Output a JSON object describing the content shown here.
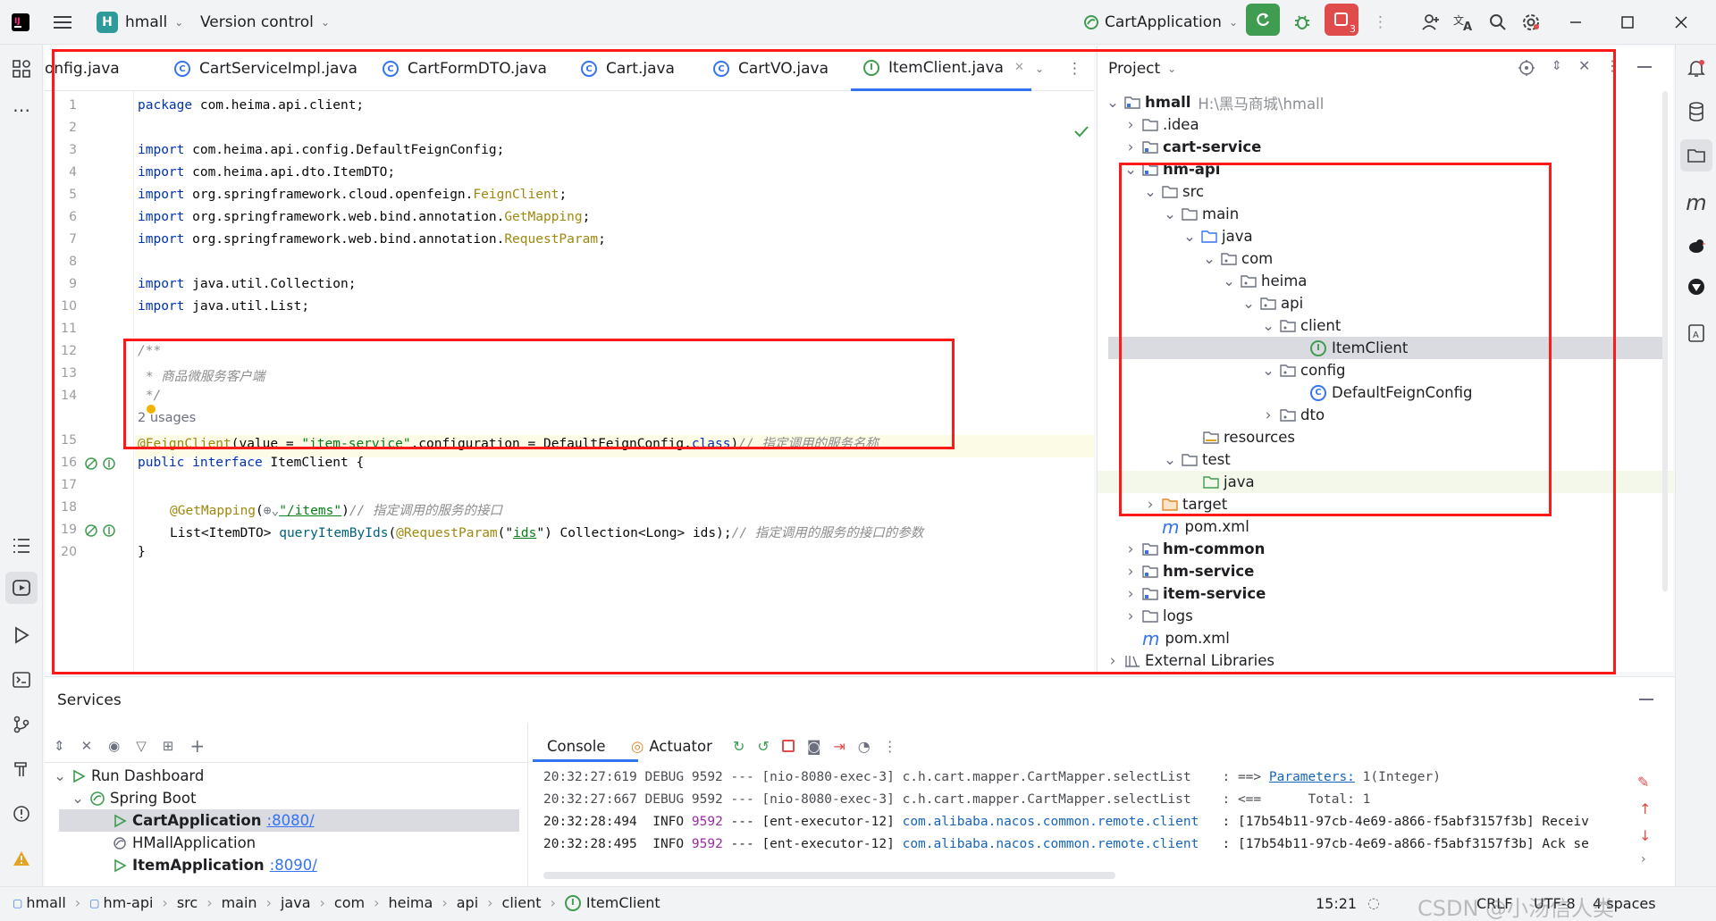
{
  "titlebar": {
    "project_badge": "H",
    "project_name": "hmall",
    "vcs": "Version control",
    "run_config": "CartApplication",
    "badge_count": "3"
  },
  "tabs": [
    {
      "label": "onfig.java",
      "icon": "class-icon"
    },
    {
      "label": "CartServiceImpl.java",
      "icon": "class-icon"
    },
    {
      "label": "CartFormDTO.java",
      "icon": "class-icon"
    },
    {
      "label": "Cart.java",
      "icon": "class-icon"
    },
    {
      "label": "CartVO.java",
      "icon": "class-icon"
    },
    {
      "label": "ItemClient.java",
      "icon": "interface-icon",
      "active": true
    }
  ],
  "code": {
    "line_numbers": [
      "1",
      "2",
      "3",
      "4",
      "5",
      "6",
      "7",
      "8",
      "9",
      "10",
      "11",
      "12",
      "13",
      "14",
      "15",
      "16",
      "17",
      "18",
      "19",
      "20"
    ],
    "l1_kw": "package",
    "l1": " com.heima.api.client;",
    "import": "import",
    "l3": " com.heima.api.config.DefaultFeignConfig;",
    "l4": " com.heima.api.dto.ItemDTO;",
    "l5a": " org.springframework.cloud.openfeign.",
    "l5b": "FeignClient",
    "l5c": ";",
    "l6a": " org.springframework.web.bind.annotation.",
    "l6b": "GetMapping",
    "l6c": ";",
    "l7a": " org.springframework.web.bind.annotation.",
    "l7b": "RequestParam",
    "l7c": ";",
    "l9": " java.util.Collection;",
    "l10": " java.util.List;",
    "l12": "/**",
    "l13": " * 商品微服务客户端",
    "l14": " */",
    "usages": "2 usages",
    "l15a": "@FeignClient",
    "l15b": "(value = ",
    "l15c": "\"item-service\"",
    "l15d": ",configuration = DefaultFeignConfig.",
    "l15e": "class",
    "l15f": ")",
    "l15g": "// 指定调用的服务名称",
    "l16a": "public interface",
    "l16b": " ItemClient {",
    "l18a": "@GetMapping",
    "l18b": "(",
    "l18c": "\"/items\"",
    "l18d": ")",
    "l18e": "// 指定调用的服务的接口",
    "l19a": "List<ItemDTO> ",
    "l19b": "queryItemByIds",
    "l19c": "(",
    "l19d": "@RequestParam",
    "l19e": "(\"",
    "l19f": "ids",
    "l19g": "\") Collection<Long> ids);",
    "l19h": "// 指定调用的服务的接口的参数",
    "l20": "}"
  },
  "project": {
    "title": "Project",
    "root": "hmall",
    "root_path": "H:\\黑马商城\\hmall",
    "nodes": {
      "idea": ".idea",
      "cart_service": "cart-service",
      "hm_api": "hm-api",
      "src": "src",
      "main": "main",
      "java": "java",
      "com": "com",
      "heima": "heima",
      "api": "api",
      "client": "client",
      "item_client": "ItemClient",
      "config": "config",
      "default_feign_config": "DefaultFeignConfig",
      "dto": "dto",
      "resources": "resources",
      "test": "test",
      "test_java": "java",
      "target": "target",
      "pom1": "pom.xml",
      "hm_common": "hm-common",
      "hm_service": "hm-service",
      "item_service": "item-service",
      "logs": "logs",
      "pom2": "pom.xml",
      "ext_libs": "External Libraries"
    }
  },
  "services": {
    "title": "Services",
    "tree": {
      "run_dashboard": "Run Dashboard",
      "spring_boot": "Spring Boot",
      "cart_app": "CartApplication",
      "cart_port": ":8080/",
      "hmall_app": "HMallApplication",
      "item_app": "ItemApplication",
      "item_port": ":8090/"
    },
    "tabs": {
      "console": "Console",
      "actuator": "Actuator"
    },
    "logs": [
      {
        "a": "20:32:27:619 DEBUG 9592 --- [nio-8080-exec-3] c.h.cart.mapper.CartMapper.selectList    : ==> ",
        "b": "Parameters:",
        "c": " 1(Integer)"
      },
      {
        "a": "20:32:27:667 DEBUG 9592 --- [nio-8080-exec-3] c.h.cart.mapper.CartMapper.selectList    : <==      Total: 1",
        "b": "",
        "c": ""
      },
      {
        "a": "20:32:28:494  INFO ",
        "b": "9592",
        "c": " --- [ent-executor-12] ",
        "d": "com.alibaba.nacos.common.remote.client",
        "e": "   : [17b54b11-97cb-4e69-a866-f5abf3157f3b] Receiv"
      },
      {
        "a": "20:32:28:495  INFO ",
        "b": "9592",
        "c": " --- [ent-executor-12] ",
        "d": "com.alibaba.nacos.common.remote.client",
        "e": "   : [17b54b11-97cb-4e69-a866-f5abf3157f3b] Ack se"
      }
    ]
  },
  "statusbar": {
    "crumbs": [
      "hmall",
      "hm-api",
      "src",
      "main",
      "java",
      "com",
      "heima",
      "api",
      "client",
      "ItemClient"
    ],
    "position": "15:21",
    "line_sep": "CRLF",
    "encoding": "UTF-8",
    "indent": "4 spaces",
    "watermark": "CSDN @小汤信人类"
  },
  "colors": {
    "accent": "#3574f0",
    "annotation_box": "#ff1a1a",
    "run_green": "#3f9c50",
    "stop_red": "#e04b4b"
  }
}
